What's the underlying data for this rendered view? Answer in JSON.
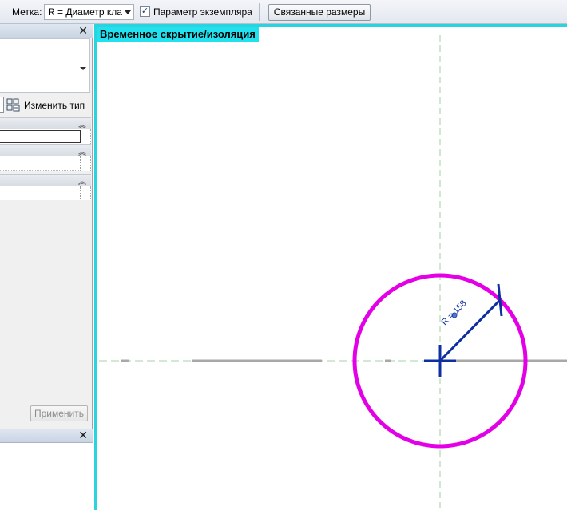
{
  "options_bar": {
    "label_caption": "Метка:",
    "label_value": "R = Диаметр кла",
    "instance_param_checked": true,
    "instance_param_label": "Параметр экземпляра",
    "associated_dims_label": "Связанные размеры"
  },
  "properties": {
    "close_glyph": "✕",
    "edit_type_label": "Изменить тип",
    "apply_label": "Применить",
    "group_chevron": "︽"
  },
  "lower_palette": {
    "close_glyph": "✕"
  },
  "canvas": {
    "isolation_banner": "Временное скрытие/изоляция",
    "dimension_text": "R = 158",
    "colors": {
      "circle": "#e400e6",
      "dimension": "#0f2fa0",
      "border": "#2ad4de",
      "reference_line": "#9fd29f"
    }
  }
}
